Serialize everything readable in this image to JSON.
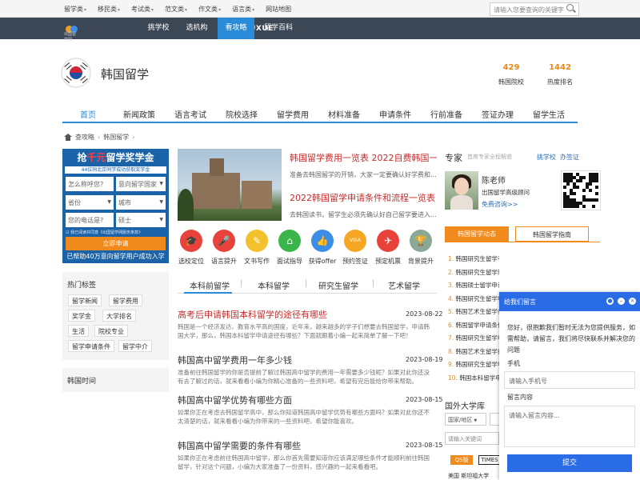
{
  "topnav": {
    "items": [
      "留学类",
      "移民类",
      "考试类",
      "范文类",
      "作文类",
      "语言类",
      "网站地图"
    ],
    "search_placeholder": "请输入您要查询的关键字"
  },
  "brand": {
    "logo_text": "LIUXUE",
    "logo_sub": "出国留学网"
  },
  "darknav": {
    "items": [
      "挑学校",
      "选机构",
      "看攻略",
      "留学百科"
    ],
    "active": "看攻略"
  },
  "country": {
    "title": "韩国留学",
    "stats": [
      {
        "value": "429",
        "label": "韩国院校"
      },
      {
        "value": "1442",
        "label": "热度排名"
      }
    ]
  },
  "main_tabs": [
    "首页",
    "新闻政策",
    "语言考试",
    "院校选择",
    "留学费用",
    "材料准备",
    "申请条件",
    "行前准备",
    "签证办理",
    "留学生活"
  ],
  "breadcrumb": [
    "查攻略",
    "韩国留学"
  ],
  "promo": {
    "headline_pre": "抢",
    "headline_red": "千元",
    "headline_post": "留学奖学金",
    "sub": "44位同北京同学成功获取奖学金",
    "fields": {
      "name": "怎么称呼您?",
      "country": "意向留学国家",
      "province": "省份",
      "city": "城市",
      "phone": "您的电话是?",
      "degree": "硕士"
    },
    "agree": "我已阅读并同意《出国留学网服务条款》",
    "button": "立即申请",
    "footer": "已帮助40万意向留学用户成功入学"
  },
  "hot_tags": {
    "title": "热门标签",
    "tags": [
      "留学新闻",
      "留学费用",
      "奖学金",
      "大学排名",
      "生活",
      "院校专业",
      "留学申请条件",
      "留学中介"
    ]
  },
  "korea_time": {
    "title": "韩国时间"
  },
  "featured": [
    {
      "title": "韩国留学费用一览表 2022自费韩国一",
      "desc": "准备去韩国留学的开销，大家一定要确认好学费和..."
    },
    {
      "title": "2022韩国留学申请条件和流程一览表",
      "desc": "去韩国读书，留学生必须先确认好自己留学要进入..."
    }
  ],
  "service_icons": [
    {
      "label": "选校定位",
      "icon": "graduation-cap-icon",
      "color": "#e8423a",
      "sym": "🎓"
    },
    {
      "label": "语言提升",
      "icon": "microphone-icon",
      "color": "#e8423a",
      "sym": "🎤"
    },
    {
      "label": "文书写作",
      "icon": "pencil-icon",
      "color": "#f3c12b",
      "sym": "✎"
    },
    {
      "label": "面试指导",
      "icon": "house-icon",
      "color": "#39b54a",
      "sym": "⌂"
    },
    {
      "label": "获得offer",
      "icon": "thumbs-up-icon",
      "color": "#3a8ee6",
      "sym": "👍"
    },
    {
      "label": "预约签证",
      "icon": "visa-icon",
      "color": "#f5a623",
      "sym": "VISA"
    },
    {
      "label": "预定机票",
      "icon": "airplane-icon",
      "color": "#e8423a",
      "sym": "✈"
    },
    {
      "label": "背景提升",
      "icon": "trophy-icon",
      "color": "#8aa894",
      "sym": "🏆"
    }
  ],
  "sub_tabs": [
    "本科前留学",
    "本科留学",
    "研究生留学",
    "艺术留学"
  ],
  "articles": [
    {
      "title": "高考后申请韩国本科留学的途径有哪些",
      "date": "2023-08-22",
      "desc": "韩国是一个经济发达、教育水平高的国度，近年来，越来越多的学子们想要去韩国留学，申请韩国大学，那么，韩国本科留学申请途径有哪些？下面就跟着小编一起来简单了解一下吧！"
    },
    {
      "title": "韩国高中留学费用一年多少钱",
      "date": "2023-08-19",
      "desc": "准备前往韩国留学的你是否提前了解过韩国高中留学的费用一年需要多少钱呢？如果对此你还没有去了解过的话，就来看看小编为你精心准备的一些资料吧，希望有完后能给你带来帮助。"
    },
    {
      "title": "韩国高中留学优势有哪些方面",
      "date": "2023-08-15",
      "desc": "如果你正在考虑去韩国留学高中，那么你知道韩国高中留学优势有哪些方面吗？如果对此你还不太清楚的话，就来看看小编为你带来的一些资料吧，希望你能喜欢。"
    },
    {
      "title": "韩国高中留学需要的条件有哪些",
      "date": "2023-08-15",
      "desc": "如果你正在考虑前往韩国高中留学，那么你首先需要知道你应该满足哪些条件才能顺利前往韩国留学，针对这个问题，小编为大家准备了一份资料，感兴趣的一起来看看吧。"
    }
  ],
  "expert": {
    "title": "专家",
    "subtitle": "首席专家全程解惑",
    "links": [
      "挑学校",
      "办签证"
    ],
    "name": "陈老师",
    "position": "出国留学高级顾问",
    "consult": "免费咨询>>"
  },
  "right_tabs": [
    "韩国留学动态",
    "韩国留学指南"
  ],
  "news_list": [
    "韩国研究生留学有哪些优势专业推荐？",
    "韩国研究生留学热门专业推荐有哪些",
    "韩国硕士留学申请费用汇总",
    "韩国研究生留学申请条件",
    "韩国艺术生留学条件",
    "韩国留学申请条件",
    "韩国研究生留学申请流程",
    "韩国艺术生留学费用",
    "韩国研究生留学申请材料",
    "韩国本科留学申请条件"
  ],
  "uni": {
    "title": "国外大学库",
    "region": "国家/地区",
    "input_placeholder": "请输入关键词",
    "rank_tabs": [
      "QS版",
      "TIMES"
    ],
    "bottom": "美国 斯坦福大学"
  },
  "chat": {
    "title": "给我们留言",
    "message": "您好，很抱歉我们暂时无法为您提供服务，如需帮助，请留言，我们将尽快联系并解决您的问题",
    "phone_label": "手机",
    "phone_placeholder": "请输入手机号",
    "content_label": "留言内容",
    "content_placeholder": "请输入留言内容...",
    "submit": "提交"
  }
}
